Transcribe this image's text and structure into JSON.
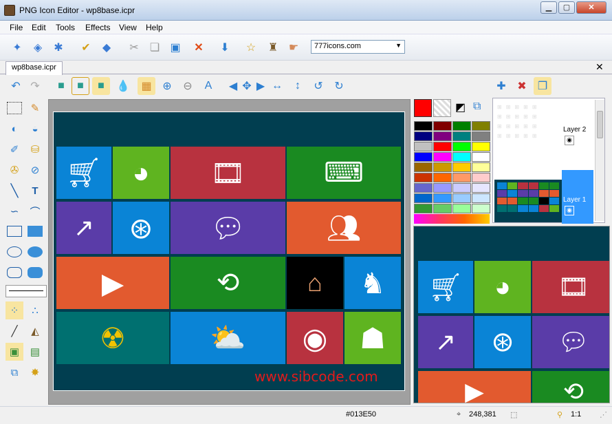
{
  "window": {
    "title": "PNG Icon Editor - wp8base.icpr"
  },
  "menu": [
    "File",
    "Edit",
    "Tools",
    "Effects",
    "View",
    "Help"
  ],
  "toolbar": {
    "site_select_value": "777icons.com"
  },
  "document": {
    "tab_label": "wp8base.icpr"
  },
  "canvas": {
    "bg_color": "#013e50",
    "site_url": "www.sibcode.com"
  },
  "layers": {
    "layer2_label": "Layer 2",
    "layer1_label": "Layer 1"
  },
  "status": {
    "color_hex": "#013E50",
    "coords": "248,381",
    "zoom": "1:1"
  },
  "colors": {
    "primary": "#ff0000"
  },
  "palette": [
    "#000000",
    "#800000",
    "#008000",
    "#808000",
    "#000080",
    "#800080",
    "#008080",
    "#808080",
    "#c0c0c0",
    "#ff0000",
    "#00ff00",
    "#ffff00",
    "#0000ff",
    "#ff00ff",
    "#00ffff",
    "#ffffff",
    "#996600",
    "#cc9900",
    "#ffcc00",
    "#ffff99",
    "#cc3300",
    "#ff6600",
    "#ff9966",
    "#ffcccc",
    "#6666cc",
    "#9999ff",
    "#ccccff",
    "#e6e6ff",
    "#0066cc",
    "#3399ff",
    "#99ccff",
    "#cce6ff",
    "#339933",
    "#66cc66",
    "#99ff99",
    "#ccffcc"
  ]
}
